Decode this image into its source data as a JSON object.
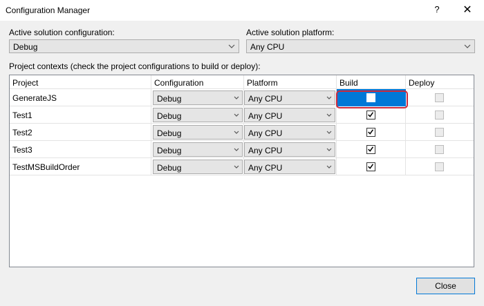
{
  "window": {
    "title": "Configuration Manager",
    "help_label": "?",
    "close_label": "✕"
  },
  "active_config": {
    "label": "Active solution configuration:",
    "value": "Debug"
  },
  "active_platform": {
    "label": "Active solution platform:",
    "value": "Any CPU"
  },
  "contexts_label": "Project contexts (check the project configurations to build or deploy):",
  "columns": [
    "Project",
    "Configuration",
    "Platform",
    "Build",
    "Deploy"
  ],
  "rows": [
    {
      "project": "GenerateJS",
      "configuration": "Debug",
      "platform": "Any CPU",
      "build": false,
      "deploy": false,
      "selected": true
    },
    {
      "project": "Test1",
      "configuration": "Debug",
      "platform": "Any CPU",
      "build": true,
      "deploy": false,
      "selected": false
    },
    {
      "project": "Test2",
      "configuration": "Debug",
      "platform": "Any CPU",
      "build": true,
      "deploy": false,
      "selected": false
    },
    {
      "project": "Test3",
      "configuration": "Debug",
      "platform": "Any CPU",
      "build": true,
      "deploy": false,
      "selected": false
    },
    {
      "project": "TestMSBuildOrder",
      "configuration": "Debug",
      "platform": "Any CPU",
      "build": true,
      "deploy": false,
      "selected": false
    }
  ],
  "close_button": "Close",
  "colors": {
    "selection": "#0078d7",
    "highlight_ring": "#cc2a3c"
  }
}
